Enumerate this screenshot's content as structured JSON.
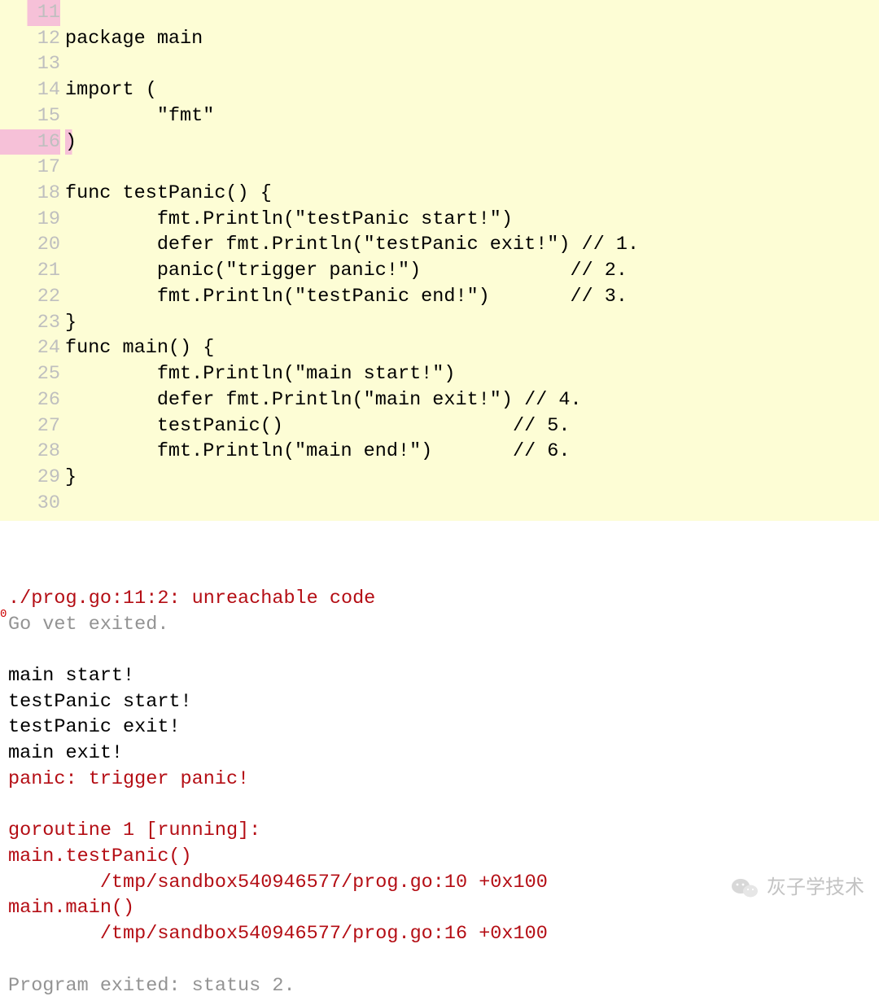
{
  "editor": {
    "lines": [
      {
        "num": "11",
        "code": " ",
        "gutter_class": "partial-hl"
      },
      {
        "num": "12",
        "code": "package main"
      },
      {
        "num": "13",
        "code": " "
      },
      {
        "num": "14",
        "code": "import ("
      },
      {
        "num": "15",
        "code": "        \"fmt\""
      },
      {
        "num": "16",
        "code": ")",
        "gutter_class": "hl-pink",
        "code_class": "hl-pink-extra"
      },
      {
        "num": "17",
        "code": " "
      },
      {
        "num": "18",
        "code": "func testPanic() {"
      },
      {
        "num": "19",
        "code": "        fmt.Println(\"testPanic start!\")"
      },
      {
        "num": "20",
        "code": "        defer fmt.Println(\"testPanic exit!\") // 1."
      },
      {
        "num": "21",
        "code": "        panic(\"trigger panic!\")             // 2."
      },
      {
        "num": "22",
        "code": "        fmt.Println(\"testPanic end!\")       // 3."
      },
      {
        "num": "23",
        "code": "}"
      },
      {
        "num": "24",
        "code": "func main() {"
      },
      {
        "num": "25",
        "code": "        fmt.Println(\"main start!\")"
      },
      {
        "num": "26",
        "code": "        defer fmt.Println(\"main exit!\") // 4."
      },
      {
        "num": "27",
        "code": "        testPanic()                    // 5."
      },
      {
        "num": "28",
        "code": "        fmt.Println(\"main end!\")       // 6."
      },
      {
        "num": "29",
        "code": "}"
      },
      {
        "num": "30",
        "code": " "
      }
    ]
  },
  "console": {
    "lines": [
      {
        "text": "./prog.go:11:2: unreachable code",
        "class": "cc-red"
      },
      {
        "text": "Go vet exited.",
        "class": "cc-gray"
      },
      {
        "text": " ",
        "class": "cc-gray"
      },
      {
        "text": "main start!",
        "class": "cc-black"
      },
      {
        "text": "testPanic start!",
        "class": "cc-black"
      },
      {
        "text": "testPanic exit!",
        "class": "cc-black"
      },
      {
        "text": "main exit!",
        "class": "cc-black"
      },
      {
        "text": "panic: trigger panic!",
        "class": "cc-red"
      },
      {
        "text": " ",
        "class": "cc-red"
      },
      {
        "text": "goroutine 1 [running]:",
        "class": "cc-red"
      },
      {
        "text": "main.testPanic()",
        "class": "cc-red"
      },
      {
        "text": "        /tmp/sandbox540946577/prog.go:10 +0x100",
        "class": "cc-red"
      },
      {
        "text": "main.main()",
        "class": "cc-red"
      },
      {
        "text": "        /tmp/sandbox540946577/prog.go:16 +0x100",
        "class": "cc-red"
      },
      {
        "text": " ",
        "class": "cc-gray"
      },
      {
        "text": "Program exited: status 2.",
        "class": "cc-gray"
      }
    ],
    "tiny_marker": "0"
  },
  "watermark": {
    "text": "灰子学技术"
  }
}
